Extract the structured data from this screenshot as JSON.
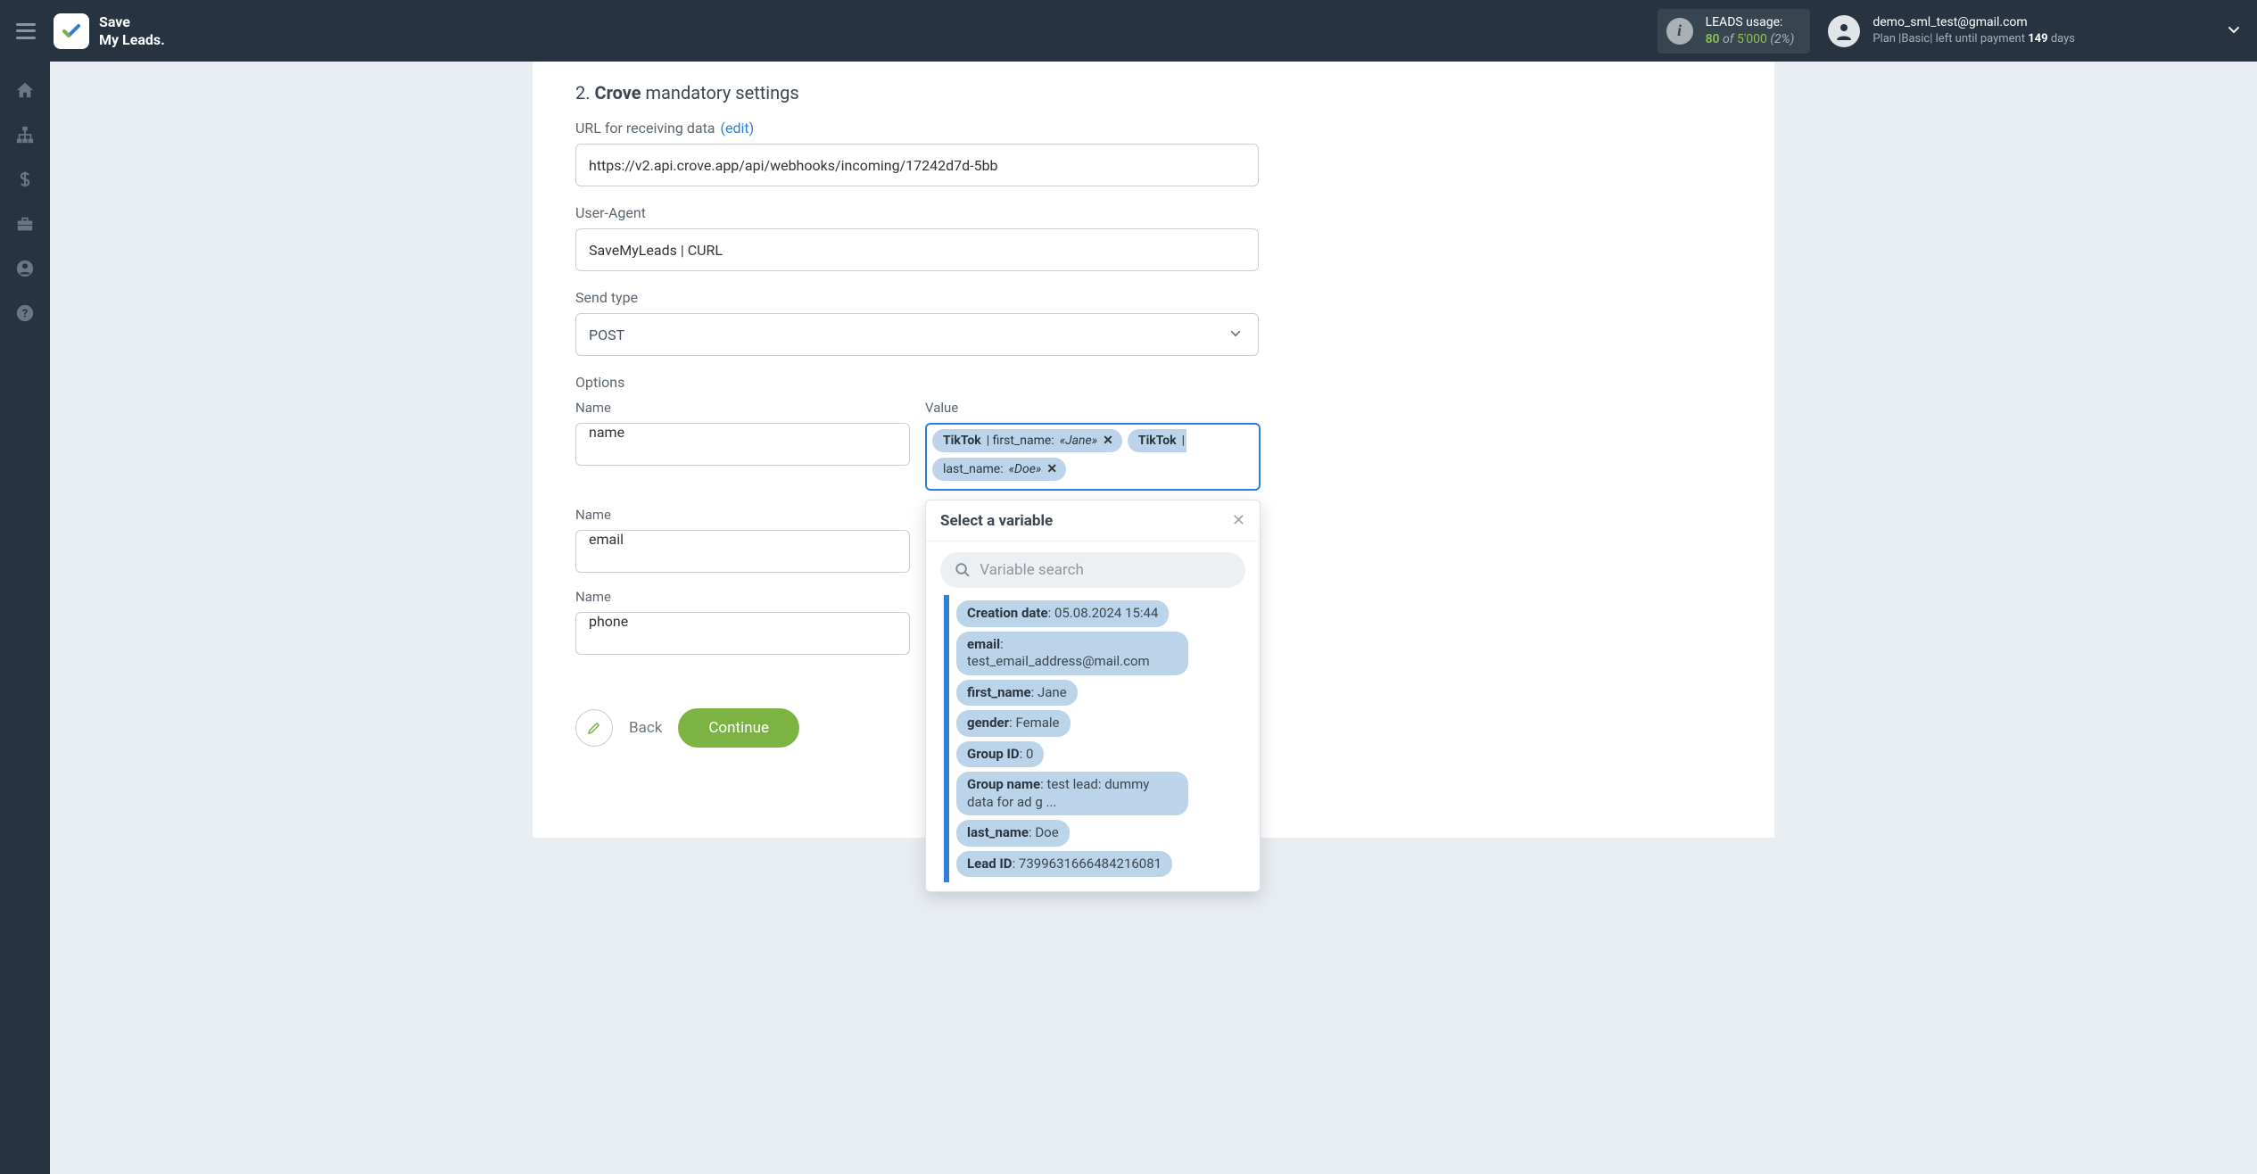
{
  "header": {
    "brand_line1": "Save",
    "brand_line2": "My Leads.",
    "usage_label": "LEADS usage:",
    "usage_used": "80",
    "usage_of": "of",
    "usage_total": "5'000",
    "usage_pct": "(2%)",
    "account_email": "demo_sml_test@gmail.com",
    "plan_prefix": "Plan |",
    "plan_name": "Basic",
    "plan_suffix": "| left until payment ",
    "plan_days_num": "149",
    "plan_days_word": " days"
  },
  "section": {
    "number": "2.",
    "name": "Crove",
    "rest": " mandatory settings",
    "url_label": "URL for receiving data ",
    "url_edit": "(edit)",
    "url_value": "https://v2.api.crove.app/api/webhooks/incoming/17242d7d-5bb",
    "ua_label": "User-Agent",
    "ua_value": "SaveMyLeads | CURL",
    "sendtype_label": "Send type",
    "sendtype_value": "POST",
    "options_label": "Options",
    "col_name": "Name",
    "col_value": "Value",
    "rows": [
      {
        "name": "name"
      },
      {
        "name": "email"
      },
      {
        "name": "phone"
      }
    ],
    "chip1_src": "TikTok",
    "chip1_field": " | first_name: ",
    "chip1_ex": "«Jane»",
    "chip2a_src": "TikTok",
    "chip2a_sep": " | ",
    "chip2b_field": "last_name: ",
    "chip2b_ex": "«Doe»",
    "back_label": "Back",
    "continue_label": "Continue"
  },
  "dropdown": {
    "title": "Select a variable",
    "search_placeholder": "Variable search",
    "items": [
      {
        "key": "Creation date",
        "val": ": 05.08.2024 15:44"
      },
      {
        "key": "email",
        "val": ": test_email_address@mail.com"
      },
      {
        "key": "first_name",
        "val": ": Jane"
      },
      {
        "key": "gender",
        "val": ": Female"
      },
      {
        "key": "Group ID",
        "val": ": 0"
      },
      {
        "key": "Group name",
        "val": ": test lead: dummy data for ad g ..."
      },
      {
        "key": "last_name",
        "val": ": Doe"
      },
      {
        "key": "Lead ID",
        "val": ": 7399631666484216081"
      }
    ]
  }
}
